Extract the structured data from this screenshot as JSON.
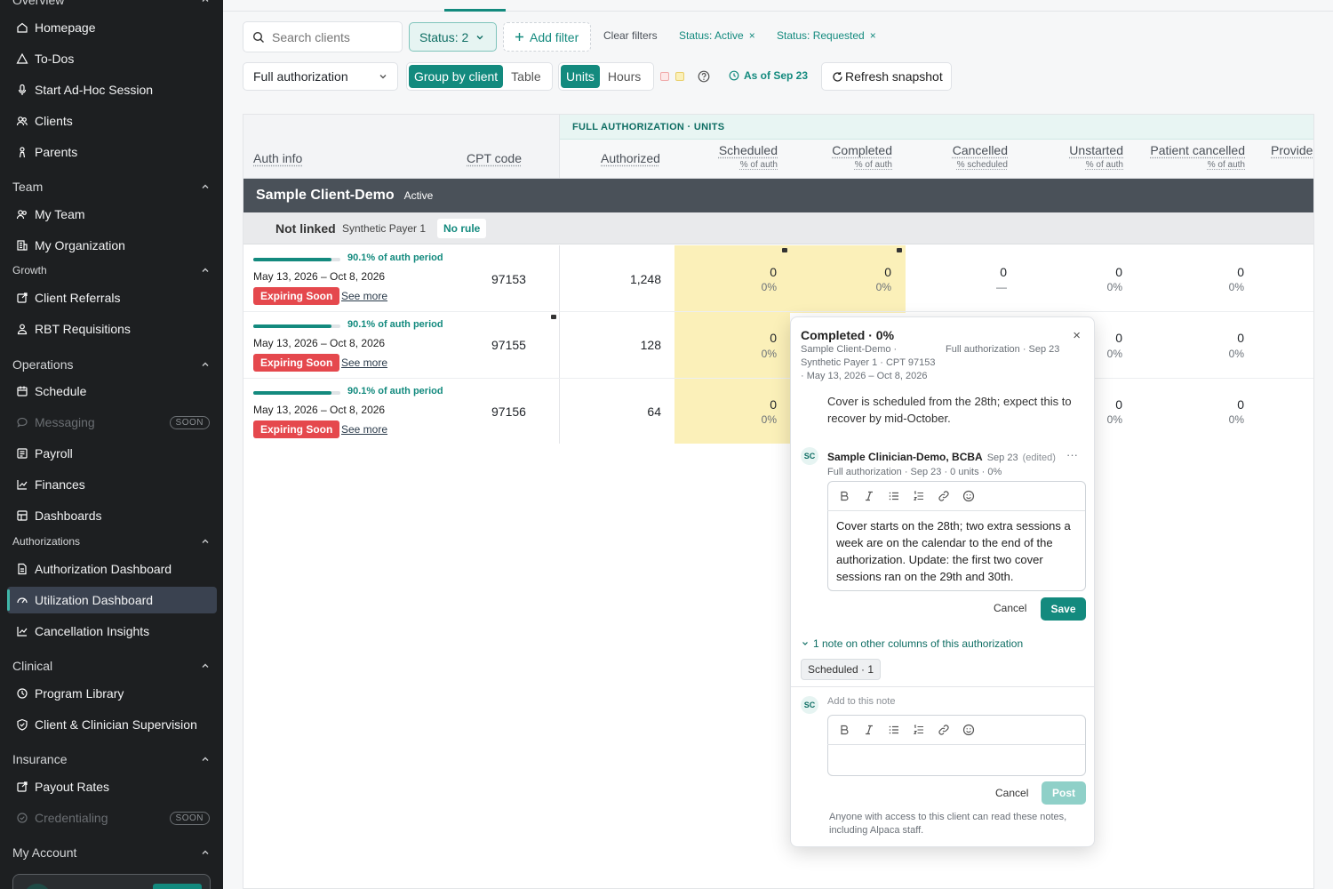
{
  "sidebar": {
    "overview_heading": "Overview",
    "homepage": "Homepage",
    "todos": "To-Dos",
    "adhoc": "Start Ad-Hoc Session",
    "clients": "Clients",
    "parents": "Parents",
    "team_heading": "Team",
    "my_team": "My Team",
    "my_org": "My Organization",
    "growth_heading": "Growth",
    "client_referrals": "Client Referrals",
    "rbt_requisitions": "RBT Requisitions",
    "operations_heading": "Operations",
    "schedule": "Schedule",
    "messaging": "Messaging",
    "messaging_badge": "SOON",
    "payroll": "Payroll",
    "finances": "Finances",
    "dashboards": "Dashboards",
    "authorizations_heading": "Authorizations",
    "auth_dashboard": "Authorization Dashboard",
    "util_dashboard": "Utilization Dashboard",
    "cancel_insights": "Cancellation Insights",
    "clinical_heading": "Clinical",
    "program_library": "Program Library",
    "supervision": "Client & Clinician Supervision",
    "insurance_heading": "Insurance",
    "payout_rates": "Payout Rates",
    "credentialing": "Credentialing",
    "credentialing_badge": "SOON",
    "account_heading": "My Account"
  },
  "filters": {
    "search_placeholder": "Search clients",
    "status": "Status: 2",
    "add_filter": "Add filter",
    "clear": "Clear filters",
    "chip1": "Status: Active",
    "chip2": "Status: Requested",
    "auth_select": "Full authorization",
    "group_by_client": "Group by client",
    "table": "Table",
    "units": "Units",
    "hours": "Hours",
    "as_of": "As of Sep 23",
    "refresh": "Refresh snapshot"
  },
  "table": {
    "band": "FULL AUTHORIZATION · UNITS",
    "headers": {
      "auth_info": "Auth info",
      "cpt": "CPT code",
      "authorized": "Authorized",
      "scheduled": "Scheduled",
      "scheduled_sub": "% of auth",
      "completed": "Completed",
      "completed_sub": "% of auth",
      "cancelled": "Cancelled",
      "cancelled_sub": "% scheduled",
      "unstarted": "Unstarted",
      "unstarted_sub": "% of auth",
      "patient_cancelled": "Patient cancelled",
      "patient_cancelled_sub": "% of auth",
      "provider": "Provide"
    },
    "client_name": "Sample Client-Demo",
    "client_status": "Active",
    "link_status": "Not linked",
    "payer": "Synthetic Payer 1",
    "rule": "No rule",
    "rows": [
      {
        "progress_label": "90.1% of auth period",
        "progress": 0.901,
        "dates": "May 13, 2026 – Oct 8, 2026",
        "badge": "Expiring Soon",
        "see_more": "See more",
        "cpt": "97153",
        "authorized": "1,248",
        "scheduled": "0",
        "scheduled_pct": "0%",
        "completed": "0",
        "completed_pct": "0%",
        "cancelled": "0",
        "cancelled_pct": "—",
        "unstarted": "0",
        "unstarted_pct": "0%",
        "patient_cancelled": "0",
        "patient_cancelled_pct": "0%"
      },
      {
        "progress_label": "90.1% of auth period",
        "progress": 0.901,
        "dates": "May 13, 2026 – Oct 8, 2026",
        "badge": "Expiring Soon",
        "see_more": "See more",
        "cpt": "97155",
        "authorized": "128",
        "scheduled": "0",
        "scheduled_pct": "0%",
        "unstarted": "0",
        "unstarted_pct": "0%",
        "patient_cancelled": "0",
        "patient_cancelled_pct": "0%"
      },
      {
        "progress_label": "90.1% of auth period",
        "progress": 0.901,
        "dates": "May 13, 2026 – Oct 8, 2026",
        "badge": "Expiring Soon",
        "see_more": "See more",
        "cpt": "97156",
        "authorized": "64",
        "scheduled": "0",
        "scheduled_pct": "0%",
        "unstarted": "0",
        "unstarted_pct": "0%",
        "patient_cancelled": "0",
        "patient_cancelled_pct": "0%"
      }
    ]
  },
  "popover": {
    "title": "Completed · 0%",
    "meta_left_1": "Sample Client-Demo ·",
    "meta_left_2": "Synthetic Payer 1 · CPT 97153",
    "meta_left_3": "· May 13, 2026 – Oct 8, 2026",
    "meta_right": "Full authorization · Sep 23",
    "prev_note": "Cover is scheduled from the 28th; expect this to recover by mid-October.",
    "author_initials": "SC",
    "author": "Sample Clinician-Demo, BCBA",
    "author_date": "Sep 23",
    "edited": "(edited)",
    "note_meta": "Full authorization · Sep 23 · 0 units · 0%",
    "note_text": "Cover starts on the 28th; two extra sessions a week are on the calendar to the end of the authorization. Update: the first two cover sessions ran on the 29th and 30th.",
    "cancel": "Cancel",
    "save": "Save",
    "other_notes": "1 note on other columns of this authorization",
    "other_chip": "Scheduled · 1",
    "reply_initials": "SC",
    "reply_placeholder": "Add to this note",
    "reply_cancel": "Cancel",
    "post": "Post",
    "footer": "Anyone with access to this client can read these notes, including Alpaca staff."
  },
  "colors": {
    "accent": "#138a7e",
    "sidebar": "#1d1f21",
    "danger": "#e5484d",
    "highlight": "#fbf0b9"
  }
}
